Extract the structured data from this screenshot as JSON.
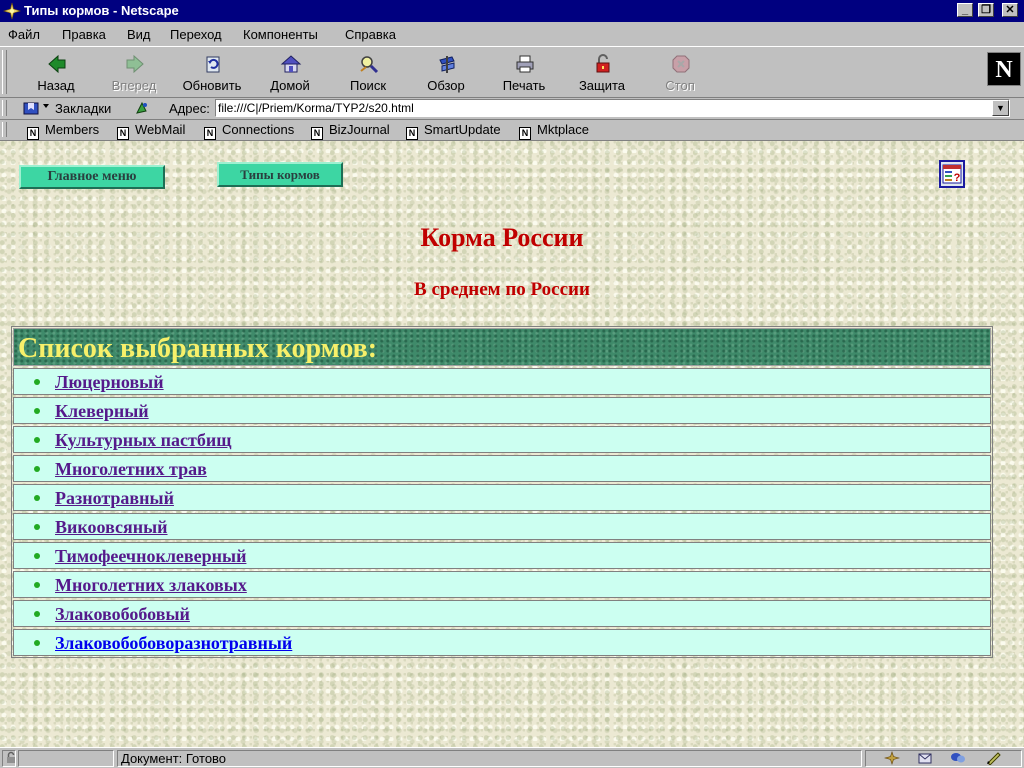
{
  "window": {
    "title": "Типы кормов - Netscape",
    "controls": {
      "minimize": "_",
      "restore": "❐",
      "close": "✕"
    }
  },
  "menu": [
    {
      "label": "Файл"
    },
    {
      "label": "Правка"
    },
    {
      "label": "Вид"
    },
    {
      "label": "Переход"
    },
    {
      "label": "Компоненты"
    },
    {
      "label": "Справка"
    }
  ],
  "toolbar": {
    "buttons": [
      {
        "label": "Назад",
        "icon": "back-arrow-icon",
        "enabled": true
      },
      {
        "label": "Вперед",
        "icon": "forward-arrow-icon",
        "enabled": false
      },
      {
        "label": "Обновить",
        "icon": "reload-icon",
        "enabled": true
      },
      {
        "label": "Домой",
        "icon": "home-icon",
        "enabled": true
      },
      {
        "label": "Поиск",
        "icon": "search-icon",
        "enabled": true
      },
      {
        "label": "Обзор",
        "icon": "guide-icon",
        "enabled": true
      },
      {
        "label": "Печать",
        "icon": "print-icon",
        "enabled": true
      },
      {
        "label": "Защита",
        "icon": "security-lock-icon",
        "enabled": true
      },
      {
        "label": "Стоп",
        "icon": "stop-icon",
        "enabled": false
      }
    ],
    "logo": "N"
  },
  "location": {
    "bookmarks_label": "Закладки",
    "address_label": "Адрес:",
    "address_value": "file:///C|/Priem/Korma/TYP2/s20.html"
  },
  "personal_toolbar": [
    {
      "label": "Members"
    },
    {
      "label": "WebMail"
    },
    {
      "label": "Connections"
    },
    {
      "label": "BizJournal"
    },
    {
      "label": "SmartUpdate"
    },
    {
      "label": "Mktplace"
    }
  ],
  "page": {
    "nav_buttons": {
      "main_menu": "Главное меню",
      "feed_types": "Типы кормов"
    },
    "title": "Корма России",
    "subtitle": "В среднем по России",
    "list_header": "Список выбранных кормов:",
    "items": [
      {
        "label": "Люцерновый",
        "visited": true
      },
      {
        "label": "Клеверный",
        "visited": true
      },
      {
        "label": "Культурных пастбищ",
        "visited": true
      },
      {
        "label": "Многолетних трав",
        "visited": true
      },
      {
        "label": "Разнотравный",
        "visited": true
      },
      {
        "label": "Викоовсяный",
        "visited": true
      },
      {
        "label": "Тимофеечноклеверный",
        "visited": true
      },
      {
        "label": "Многолетних злаковых",
        "visited": true
      },
      {
        "label": "Злаковобобовый",
        "visited": true
      },
      {
        "label": "Злаковобобоворазнотравный",
        "visited": false
      }
    ]
  },
  "status": {
    "text": "Документ: Готово"
  },
  "colors": {
    "title_bar": "#000080",
    "page_title": "#c00000",
    "list_header_text": "#f7f06a",
    "row_bg": "#ccfff1",
    "nav_button": "#3dd6a3",
    "visited_link": "#551a8b",
    "link": "#0000ee"
  }
}
